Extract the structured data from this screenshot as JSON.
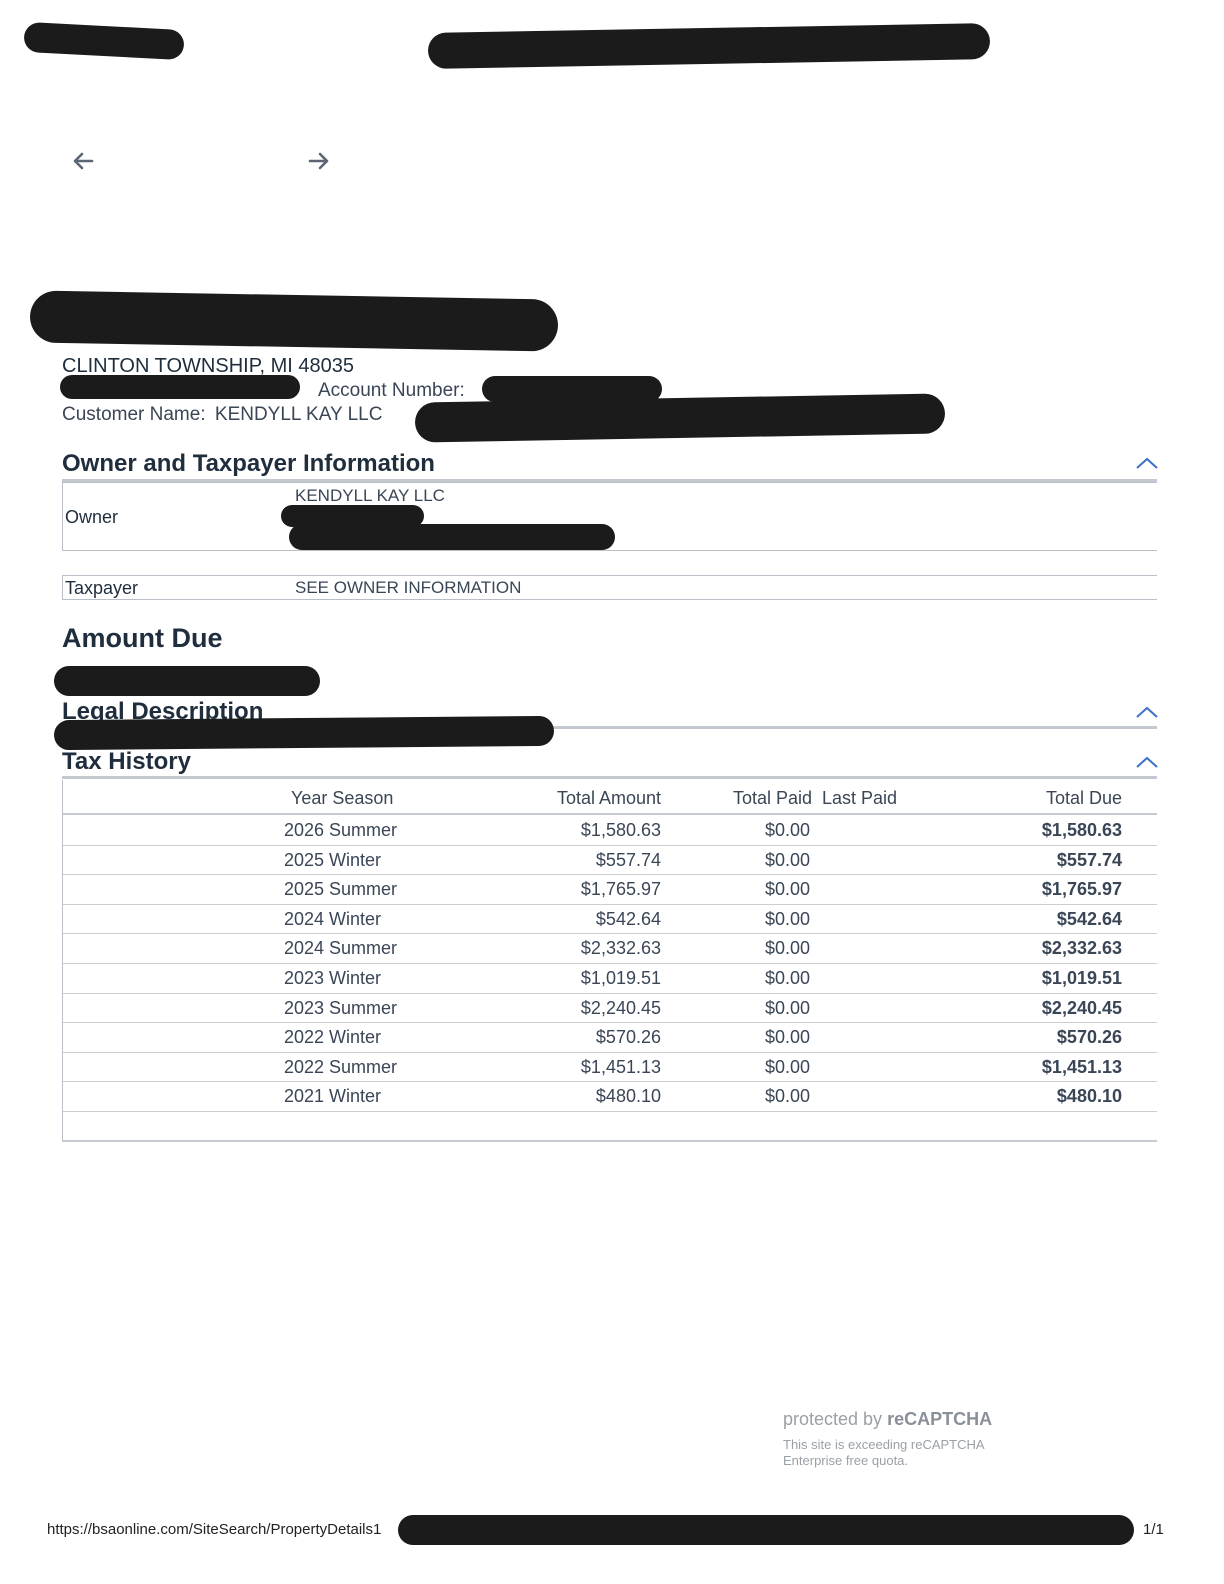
{
  "navigation": {
    "back_icon": "arrow-left-icon",
    "forward_icon": "arrow-right-icon"
  },
  "property": {
    "city_line": "CLINTON TOWNSHIP, MI 48035",
    "account_number_label": "Account Number:",
    "customer_name_label": "Customer Name:",
    "customer_name": "KENDYLL KAY LLC"
  },
  "owner_section": {
    "title": "Owner and Taxpayer Information",
    "owner_label": "Owner",
    "owner_name": "KENDYLL KAY LLC",
    "taxpayer_label": "Taxpayer",
    "taxpayer_value": "SEE OWNER INFORMATION"
  },
  "amount_due": {
    "title": "Amount Due"
  },
  "legal_description": {
    "title": "Legal Description"
  },
  "tax_history": {
    "title": "Tax History",
    "columns": [
      "Year Season",
      "Total Amount",
      "Total Paid",
      "Last Paid",
      "Total Due"
    ],
    "rows": [
      {
        "year_season": "2026 Summer",
        "total_amount": "$1,580.63",
        "total_paid": "$0.00",
        "total_due": "$1,580.63"
      },
      {
        "year_season": "2025 Winter",
        "total_amount": "$557.74",
        "total_paid": "$0.00",
        "total_due": "$557.74"
      },
      {
        "year_season": "2025 Summer",
        "total_amount": "$1,765.97",
        "total_paid": "$0.00",
        "total_due": "$1,765.97"
      },
      {
        "year_season": "2024 Winter",
        "total_amount": "$542.64",
        "total_paid": "$0.00",
        "total_due": "$542.64"
      },
      {
        "year_season": "2024 Summer",
        "total_amount": "$2,332.63",
        "total_paid": "$0.00",
        "total_due": "$2,332.63"
      },
      {
        "year_season": "2023 Winter",
        "total_amount": "$1,019.51",
        "total_paid": "$0.00",
        "total_due": "$1,019.51"
      },
      {
        "year_season": "2023 Summer",
        "total_amount": "$2,240.45",
        "total_paid": "$0.00",
        "total_due": "$2,240.45"
      },
      {
        "year_season": "2022 Winter",
        "total_amount": "$570.26",
        "total_paid": "$0.00",
        "total_due": "$570.26"
      },
      {
        "year_season": "2022 Summer",
        "total_amount": "$1,451.13",
        "total_paid": "$0.00",
        "total_due": "$1,451.13"
      },
      {
        "year_season": "2021 Winter",
        "total_amount": "$480.10",
        "total_paid": "$0.00",
        "total_due": "$480.10"
      }
    ]
  },
  "recaptcha": {
    "protected_by": "protected by",
    "brand": "reCAPTCHA",
    "quota_note": "This site is exceeding reCAPTCHA Enterprise free quota."
  },
  "footer": {
    "url": "https://bsaonline.com/SiteSearch/PropertyDetails1",
    "page_indicator": "1/1"
  },
  "colors": {
    "accent": "#3b6fc9",
    "text": "#1f2d3d",
    "redaction": "#1b1b1b"
  }
}
